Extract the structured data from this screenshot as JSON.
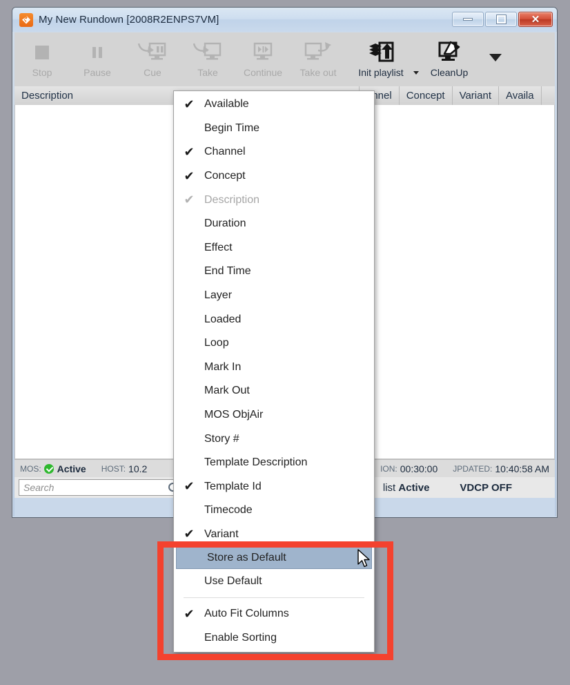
{
  "window": {
    "title": "My New Rundown [2008R2ENPS7VM]",
    "app_icon": "rundown-app-icon",
    "buttons": {
      "minimize": "Minimize",
      "maximize": "Maximize",
      "close": "Close"
    }
  },
  "toolbar": {
    "items": [
      {
        "label": "Stop",
        "icon": "stop-icon",
        "disabled": true
      },
      {
        "label": "Pause",
        "icon": "pause-icon",
        "disabled": true
      },
      {
        "label": "Cue",
        "icon": "cue-icon",
        "disabled": true
      },
      {
        "label": "Take",
        "icon": "take-icon",
        "disabled": true
      },
      {
        "label": "Continue",
        "icon": "continue-icon",
        "disabled": true
      },
      {
        "label": "Take out",
        "icon": "take-out-icon",
        "disabled": true
      },
      {
        "label": "Init playlist",
        "icon": "init-playlist-icon",
        "disabled": false
      },
      {
        "label": "CleanUp",
        "icon": "cleanup-icon",
        "disabled": false
      }
    ],
    "overflow_caret": "chevron-down-icon"
  },
  "grid": {
    "columns": [
      "Description",
      "annel",
      "Concept",
      "Variant",
      "Availa"
    ]
  },
  "status": {
    "mos_key": "MOS:",
    "mos_value": "Active",
    "host_key": "HOST:",
    "host_value": "10.2",
    "duration_key": "ION:",
    "duration_value": "00:30:00",
    "updated_key": "JPDATED:",
    "updated_value": "10:40:58 AM"
  },
  "search": {
    "placeholder": "Search"
  },
  "bottom_bar": {
    "playlist_prefix": "list",
    "playlist_state": "Active",
    "vdcp": "VDCP OFF"
  },
  "context_menu": {
    "items": [
      {
        "label": "Available",
        "checked": true,
        "disabled": false
      },
      {
        "label": "Begin Time",
        "checked": false,
        "disabled": false
      },
      {
        "label": "Channel",
        "checked": true,
        "disabled": false
      },
      {
        "label": "Concept",
        "checked": true,
        "disabled": false
      },
      {
        "label": "Description",
        "checked": true,
        "disabled": true
      },
      {
        "label": "Duration",
        "checked": false,
        "disabled": false
      },
      {
        "label": "Effect",
        "checked": false,
        "disabled": false
      },
      {
        "label": "End Time",
        "checked": false,
        "disabled": false
      },
      {
        "label": "Layer",
        "checked": false,
        "disabled": false
      },
      {
        "label": "Loaded",
        "checked": false,
        "disabled": false
      },
      {
        "label": "Loop",
        "checked": false,
        "disabled": false
      },
      {
        "label": "Mark In",
        "checked": false,
        "disabled": false
      },
      {
        "label": "Mark Out",
        "checked": false,
        "disabled": false
      },
      {
        "label": "MOS ObjAir",
        "checked": false,
        "disabled": false
      },
      {
        "label": "Story #",
        "checked": false,
        "disabled": false
      },
      {
        "label": "Template Description",
        "checked": false,
        "disabled": false
      },
      {
        "label": "Template Id",
        "checked": true,
        "disabled": false
      },
      {
        "label": "Timecode",
        "checked": false,
        "disabled": false
      },
      {
        "label": "Variant",
        "checked": true,
        "disabled": false
      },
      {
        "label": "Store as Default",
        "checked": false,
        "disabled": false,
        "highlighted": true
      },
      {
        "label": "Use Default",
        "checked": false,
        "disabled": false
      },
      {
        "separator": true
      },
      {
        "label": "Auto Fit Columns",
        "checked": true,
        "disabled": false
      },
      {
        "label": "Enable Sorting",
        "checked": false,
        "disabled": false
      }
    ],
    "check_glyph": "✔"
  },
  "annotation": {
    "color": "#f4422e",
    "label": "highlight-box"
  },
  "cursor": {
    "label": "mouse-pointer"
  }
}
